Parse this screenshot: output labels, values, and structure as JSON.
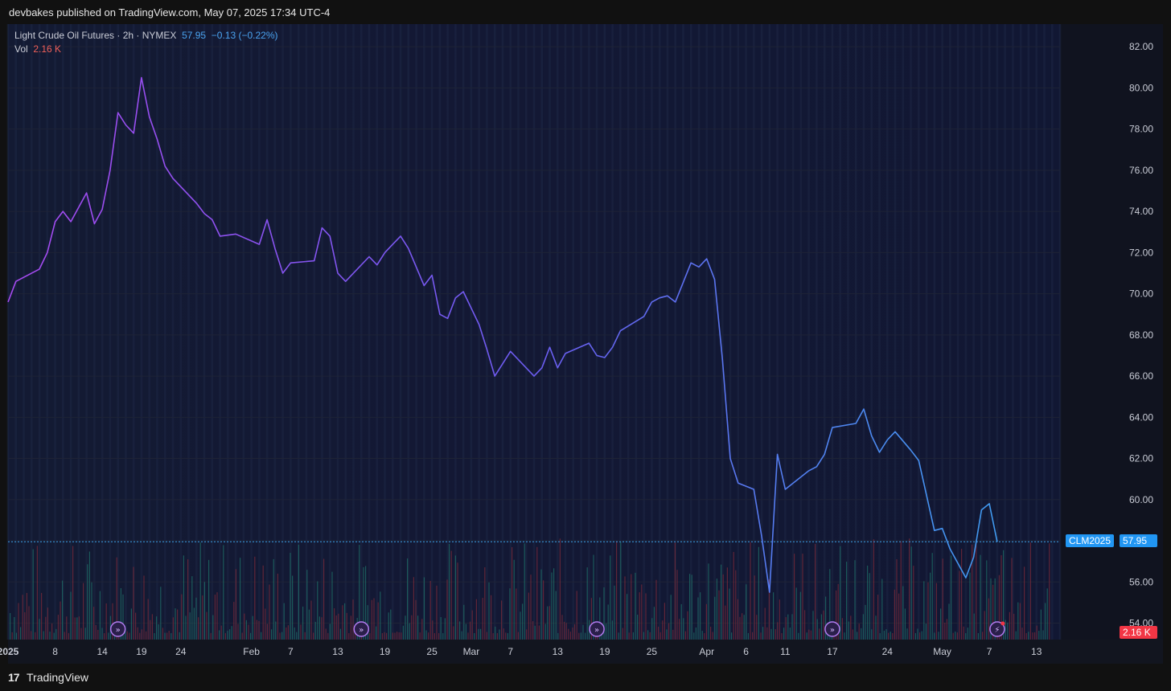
{
  "header": {
    "publish_line": "devbakes published on TradingView.com, May 07, 2025 17:34 UTC-4"
  },
  "legend": {
    "symbol_text": "Light Crude Oil Futures · 2h · NYMEX",
    "last": "57.95",
    "change": "−0.13 (−0.22%)",
    "vol_label": "Vol",
    "vol_value": "2.16 K"
  },
  "price_tag": {
    "symbol": "CLM2025",
    "value": "57.95"
  },
  "vol_tag": "2.16 K",
  "footer": {
    "brand": "TradingView",
    "logo": "TV-logo-icon"
  },
  "colors": {
    "line_start": "#a64af0",
    "line_mid": "#6b5cf0",
    "line_end": "#3aa3f0",
    "price_tag_bg": "#2196f3",
    "vol_tag_bg": "#f23645",
    "grid": "#1e2336"
  },
  "chart_data": {
    "type": "line",
    "series": [
      {
        "name": "Light Crude Oil Futures",
        "points": [
          [
            "2025-01-02",
            69.6
          ],
          [
            "2025-01-03",
            70.6
          ],
          [
            "2025-01-06",
            71.2
          ],
          [
            "2025-01-07",
            72.0
          ],
          [
            "2025-01-08",
            73.5
          ],
          [
            "2025-01-09",
            74.0
          ],
          [
            "2025-01-10",
            73.5
          ],
          [
            "2025-01-12",
            74.9
          ],
          [
            "2025-01-13",
            73.4
          ],
          [
            "2025-01-14",
            74.1
          ],
          [
            "2025-01-15",
            76.0
          ],
          [
            "2025-01-16",
            78.8
          ],
          [
            "2025-01-17",
            78.2
          ],
          [
            "2025-01-18",
            77.8
          ],
          [
            "2025-01-19",
            80.5
          ],
          [
            "2025-01-20",
            78.6
          ],
          [
            "2025-01-21",
            77.5
          ],
          [
            "2025-01-22",
            76.2
          ],
          [
            "2025-01-23",
            75.6
          ],
          [
            "2025-01-26",
            74.4
          ],
          [
            "2025-01-27",
            73.9
          ],
          [
            "2025-01-28",
            73.6
          ],
          [
            "2025-01-29",
            72.8
          ],
          [
            "2025-01-31",
            72.9
          ],
          [
            "2025-02-03",
            72.4
          ],
          [
            "2025-02-04",
            73.6
          ],
          [
            "2025-02-05",
            72.2
          ],
          [
            "2025-02-06",
            71.0
          ],
          [
            "2025-02-07",
            71.5
          ],
          [
            "2025-02-10",
            71.6
          ],
          [
            "2025-02-11",
            73.2
          ],
          [
            "2025-02-12",
            72.8
          ],
          [
            "2025-02-13",
            71.0
          ],
          [
            "2025-02-14",
            70.6
          ],
          [
            "2025-02-17",
            71.8
          ],
          [
            "2025-02-18",
            71.4
          ],
          [
            "2025-02-19",
            72.0
          ],
          [
            "2025-02-20",
            72.4
          ],
          [
            "2025-02-21",
            72.8
          ],
          [
            "2025-02-22",
            72.2
          ],
          [
            "2025-02-24",
            70.4
          ],
          [
            "2025-02-25",
            70.9
          ],
          [
            "2025-02-26",
            69.0
          ],
          [
            "2025-02-27",
            68.8
          ],
          [
            "2025-02-28",
            69.8
          ],
          [
            "2025-03-01",
            70.1
          ],
          [
            "2025-03-03",
            68.5
          ],
          [
            "2025-03-04",
            67.3
          ],
          [
            "2025-03-05",
            66.0
          ],
          [
            "2025-03-06",
            66.6
          ],
          [
            "2025-03-07",
            67.2
          ],
          [
            "2025-03-10",
            66.0
          ],
          [
            "2025-03-11",
            66.4
          ],
          [
            "2025-03-12",
            67.4
          ],
          [
            "2025-03-13",
            66.4
          ],
          [
            "2025-03-14",
            67.1
          ],
          [
            "2025-03-17",
            67.6
          ],
          [
            "2025-03-18",
            67.0
          ],
          [
            "2025-03-19",
            66.9
          ],
          [
            "2025-03-20",
            67.4
          ],
          [
            "2025-03-21",
            68.2
          ],
          [
            "2025-03-24",
            68.9
          ],
          [
            "2025-03-25",
            69.6
          ],
          [
            "2025-03-26",
            69.8
          ],
          [
            "2025-03-27",
            69.9
          ],
          [
            "2025-03-28",
            69.6
          ],
          [
            "2025-03-30",
            71.5
          ],
          [
            "2025-03-31",
            71.3
          ],
          [
            "2025-04-01",
            71.7
          ],
          [
            "2025-04-02",
            70.7
          ],
          [
            "2025-04-03",
            66.8
          ],
          [
            "2025-04-04",
            62.0
          ],
          [
            "2025-04-05",
            60.8
          ],
          [
            "2025-04-07",
            60.5
          ],
          [
            "2025-04-08",
            58.2
          ],
          [
            "2025-04-09",
            55.5
          ],
          [
            "2025-04-10",
            62.2
          ],
          [
            "2025-04-11",
            60.5
          ],
          [
            "2025-04-14",
            61.4
          ],
          [
            "2025-04-15",
            61.6
          ],
          [
            "2025-04-16",
            62.2
          ],
          [
            "2025-04-17",
            63.5
          ],
          [
            "2025-04-20",
            63.7
          ],
          [
            "2025-04-21",
            64.4
          ],
          [
            "2025-04-22",
            63.1
          ],
          [
            "2025-04-23",
            62.3
          ],
          [
            "2025-04-24",
            62.9
          ],
          [
            "2025-04-25",
            63.3
          ],
          [
            "2025-04-27",
            62.4
          ],
          [
            "2025-04-28",
            61.9
          ],
          [
            "2025-04-29",
            60.2
          ],
          [
            "2025-04-30",
            58.5
          ],
          [
            "2025-05-01",
            58.6
          ],
          [
            "2025-05-02",
            57.6
          ],
          [
            "2025-05-04",
            56.2
          ],
          [
            "2025-05-05",
            57.2
          ],
          [
            "2025-05-06",
            59.5
          ],
          [
            "2025-05-07",
            59.8
          ],
          [
            "2025-05-08",
            57.95
          ]
        ]
      },
      {
        "name": "Vol",
        "type": "bar",
        "note": "volume histogram — relative heights"
      }
    ],
    "y_ticks": [
      "82.00",
      "80.00",
      "78.00",
      "76.00",
      "74.00",
      "72.00",
      "70.00",
      "68.00",
      "66.00",
      "64.00",
      "62.00",
      "60.00",
      "58.00",
      "56.00",
      "54.00"
    ],
    "ylim": [
      53.2,
      83.1
    ],
    "x_ticks": [
      {
        "label": "2025",
        "date": "2025-01-02",
        "bold": true
      },
      {
        "label": "8",
        "date": "2025-01-08"
      },
      {
        "label": "14",
        "date": "2025-01-14"
      },
      {
        "label": "19",
        "date": "2025-01-19"
      },
      {
        "label": "24",
        "date": "2025-01-24"
      },
      {
        "label": "Feb",
        "date": "2025-02-02"
      },
      {
        "label": "7",
        "date": "2025-02-07"
      },
      {
        "label": "13",
        "date": "2025-02-13"
      },
      {
        "label": "19",
        "date": "2025-02-19"
      },
      {
        "label": "25",
        "date": "2025-02-25"
      },
      {
        "label": "Mar",
        "date": "2025-03-02"
      },
      {
        "label": "7",
        "date": "2025-03-07"
      },
      {
        "label": "13",
        "date": "2025-03-13"
      },
      {
        "label": "19",
        "date": "2025-03-19"
      },
      {
        "label": "25",
        "date": "2025-03-25"
      },
      {
        "label": "Apr",
        "date": "2025-04-01"
      },
      {
        "label": "6",
        "date": "2025-04-06"
      },
      {
        "label": "11",
        "date": "2025-04-11"
      },
      {
        "label": "17",
        "date": "2025-04-17"
      },
      {
        "label": "24",
        "date": "2025-04-24"
      },
      {
        "label": "May",
        "date": "2025-05-01"
      },
      {
        "label": "7",
        "date": "2025-05-07"
      },
      {
        "label": "13",
        "date": "2025-05-13"
      }
    ],
    "xlim": [
      "2025-01-02",
      "2025-05-16"
    ],
    "last_value": 57.95,
    "event_marker_dates": [
      "2025-01-16",
      "2025-02-16",
      "2025-03-18",
      "2025-04-17",
      "2025-05-08"
    ],
    "grid": true,
    "legend_position": "top-left"
  }
}
